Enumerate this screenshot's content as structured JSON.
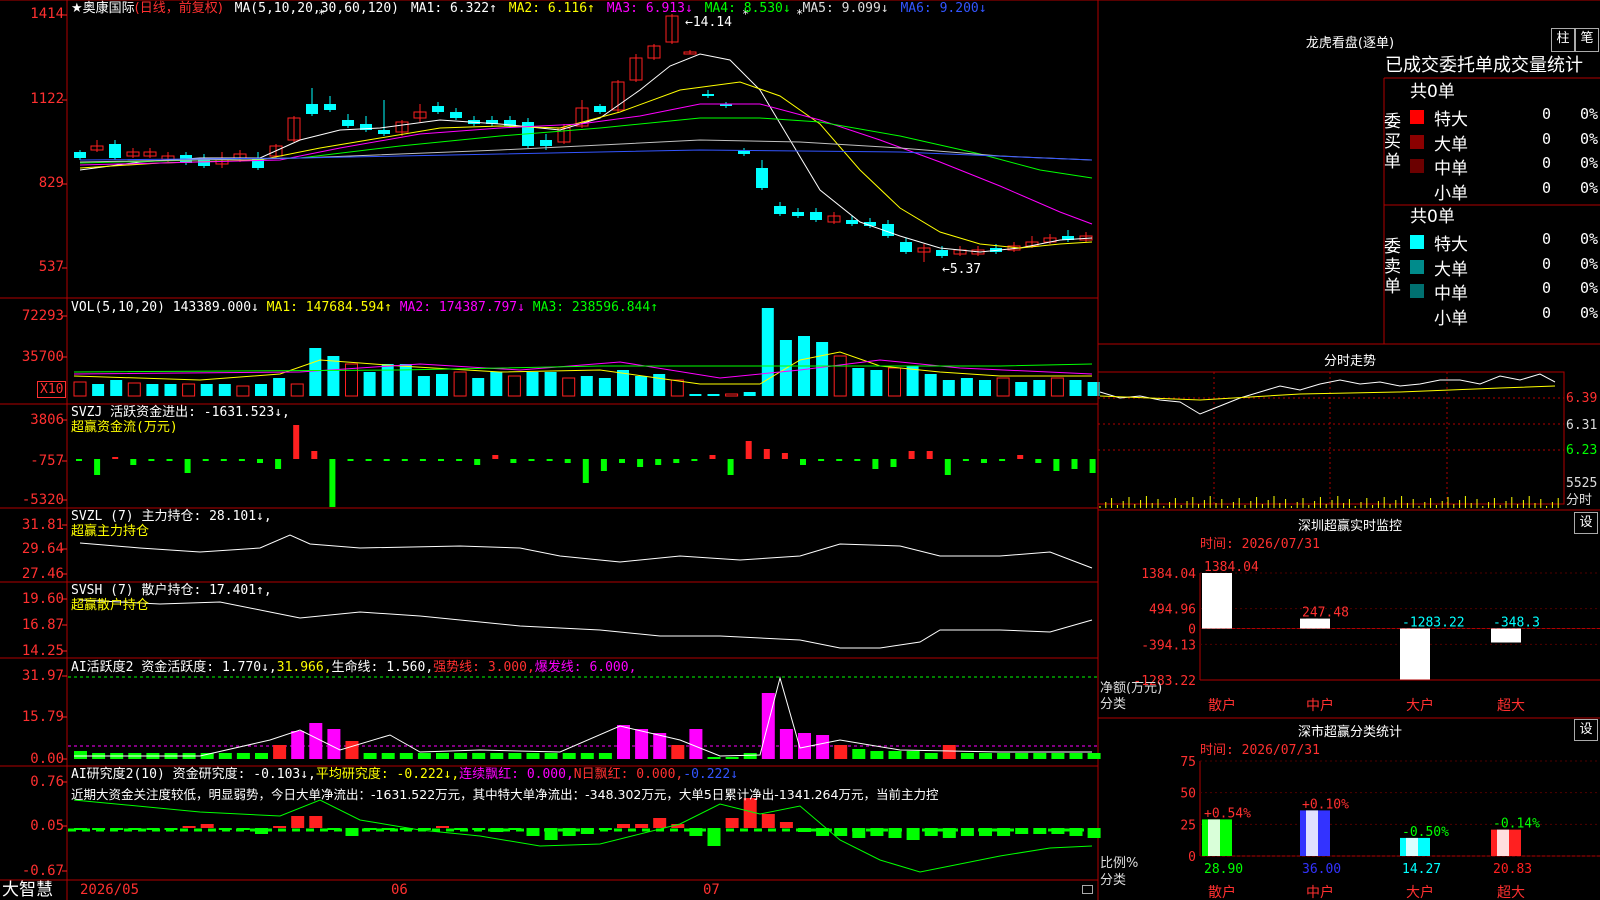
{
  "header": {
    "name": "★奥康国际",
    "mode": "(日线，前复权)",
    "ma_params": "MA(5,10,20,30,60,120)",
    "ma": [
      {
        "label": "MA1: 6.322↑",
        "color": "#ffffff"
      },
      {
        "label": "MA2: 6.116↑",
        "color": "#ffff00"
      },
      {
        "label": "MA3: 6.913↓",
        "color": "#ff00ff"
      },
      {
        "label": "MA4: 8.530↓",
        "color": "#00ff00"
      },
      {
        "label": "MA5: 9.099↓",
        "color": "#c0c0c0"
      },
      {
        "label": "MA6: 9.200↓",
        "color": "#3355ff"
      }
    ],
    "high_mark": "←14.14",
    "low_mark": "←5.37"
  },
  "price_axis": [
    "1414",
    "1122",
    "829",
    "537"
  ],
  "vol": {
    "params": "VOL(5,10,20)",
    "value": "143389.000↓",
    "ma1": "MA1: 147684.594↑",
    "ma2": "MA2: 174387.797↓",
    "ma3": "MA3: 238596.844↑",
    "axis": [
      "72293",
      "35700",
      "X10"
    ]
  },
  "svzj": {
    "line1": "SVZJ  活跃资金进出: -1631.523↓,",
    "line2": "超赢资金流(万元)",
    "axis": [
      "3806",
      "-757",
      "-5320"
    ]
  },
  "svzl": {
    "line1": "SVZL (7) 主力持仓: 28.101↓,",
    "line2": "超赢主力持仓",
    "axis": [
      "31.81",
      "29.64",
      "27.46"
    ]
  },
  "svsh": {
    "line1": "SVSH (7) 散户持仓: 17.401↑,",
    "line2": "超赢散户持仓",
    "axis": [
      "19.60",
      "16.87",
      "14.25"
    ]
  },
  "ai2": {
    "p1": "AI活跃度2 资金活跃度: 1.770↓,",
    "p2": "31.966,",
    "p3": "生命线: 1.560,",
    "p4": "强势线: 3.000,",
    "p5": "爆发线: 6.000,",
    "axis": [
      "31.97",
      "15.79",
      "0.00"
    ]
  },
  "ai_res": {
    "p1": "AI研究度2(10) 资金研究度: -0.103↓,",
    "p2": "平均研究度: -0.222↓,",
    "p3": "连续飘红: 0.000,",
    "p4": "N日飘红: 0.000,",
    "p5": "-0.222↓",
    "note": "近期大资金关注度较低，明显弱势，今日大单净流出：-1631.522万元，其中特大单净流出：-348.302万元，大单5日累计净出-1341.264万元，当前主力控",
    "axis": [
      "0.76",
      "0.05",
      "-0.67"
    ]
  },
  "date_axis": [
    "2026/05",
    "06",
    "07"
  ],
  "footer": {
    "brand": "大智慧"
  },
  "lhb": {
    "title": "龙虎看盘(逐单)",
    "btn1": "柱",
    "btn2": "笔",
    "tabs": "已成交委托单成交量统计",
    "buy_header": "共0单",
    "sell_header": "共0单",
    "buy_label": "委买单",
    "sell_label": "委卖单",
    "buy_rows": [
      {
        "name": "特大",
        "count": "0",
        "pct": "0%",
        "color": "#ff0000"
      },
      {
        "name": "大单",
        "count": "0",
        "pct": "0%",
        "color": "#8b0000"
      },
      {
        "name": "中单",
        "count": "0",
        "pct": "0%",
        "color": "#6b0000"
      },
      {
        "name": "小单",
        "count": "0",
        "pct": "0%",
        "color": ""
      }
    ],
    "sell_rows": [
      {
        "name": "特大",
        "count": "0",
        "pct": "0%",
        "color": "#00ffff"
      },
      {
        "name": "大单",
        "count": "0",
        "pct": "0%",
        "color": "#008b8b"
      },
      {
        "name": "中单",
        "count": "0",
        "pct": "0%",
        "color": "#007070"
      },
      {
        "name": "小单",
        "count": "0",
        "pct": "0%",
        "color": ""
      }
    ]
  },
  "intraday": {
    "title": "分时走势",
    "axis": [
      "6.39",
      "6.31",
      "6.23",
      "5525",
      "分时"
    ]
  },
  "monitor": {
    "title": "深圳超赢实时监控",
    "btn": "设",
    "time": "时间: 2026/07/31",
    "axis": [
      "1384.04",
      "494.96",
      "0",
      "-394.13",
      "-1283.22"
    ],
    "y_title1": "净额(万元)",
    "y_title2": "分类"
  },
  "classify": {
    "title": "深市超赢分类统计",
    "btn": "设",
    "time": "时间: 2026/07/31",
    "axis": [
      "75",
      "50",
      "25",
      "0"
    ],
    "y_title1": "比例%",
    "y_title2": "分类"
  },
  "chart_data": [
    {
      "type": "bar",
      "title": "深圳超赢实时监控",
      "categories": [
        "散户",
        "中户",
        "大户",
        "超大"
      ],
      "values": [
        1384.04,
        247.48,
        -1283.22,
        -348.3
      ],
      "labels": [
        "1384.04",
        "247.48",
        "-1283.22",
        "-348.3"
      ],
      "ylim": [
        -1283.22,
        1384.04
      ],
      "ylabel": "净额(万元)"
    },
    {
      "type": "bar",
      "title": "深市超赢分类统计",
      "categories": [
        "散户",
        "中户",
        "大户",
        "超大"
      ],
      "values": [
        28.9,
        36.0,
        14.27,
        20.83
      ],
      "labels": [
        "28.90",
        "36.00",
        "14.27",
        "20.83"
      ],
      "changes": [
        "+0.54%",
        "+0.10%",
        "-0.50%",
        "-0.14%"
      ],
      "colors": [
        "#00ff00",
        "#3333ff",
        "#00ffff",
        "#ff2020"
      ],
      "ylim": [
        0,
        75
      ],
      "ylabel": "比例%"
    }
  ]
}
